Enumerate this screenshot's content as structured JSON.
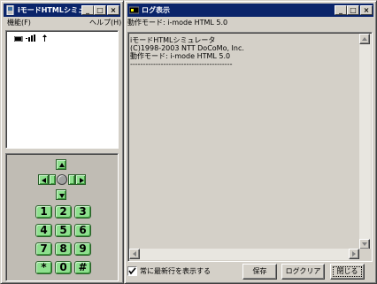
{
  "left_window": {
    "title": "iモードHTMLシミュレー",
    "menu": {
      "file": "機能(F)",
      "help": "ヘルプ(H)"
    },
    "status_icons": [
      "battery-icon",
      "signal-icon",
      "antenna-icon"
    ],
    "keypad": {
      "rows": [
        [
          "1",
          "2",
          "3"
        ],
        [
          "4",
          "5",
          "6"
        ],
        [
          "7",
          "8",
          "9"
        ],
        [
          "*",
          "0",
          "#"
        ]
      ]
    }
  },
  "right_window": {
    "title": "ログ表示",
    "mode_label": "動作モード: i-mode HTML 5.0",
    "log_lines": [
      "iモードHTMLシミュレータ",
      "(C)1998-2003 NTT DoCoMo, Inc.",
      "動作モード: i-mode HTML 5.0",
      "----------------------------------------"
    ],
    "checkbox_label": "常に最新行を表示する",
    "checkbox_checked": true,
    "buttons": {
      "save": "保存",
      "clear": "ログクリア",
      "close": "閉じる"
    }
  },
  "colors": {
    "titlebar": "#0a246a",
    "keypad_key": "#8ee08e",
    "window_face": "#d4d0c8"
  }
}
